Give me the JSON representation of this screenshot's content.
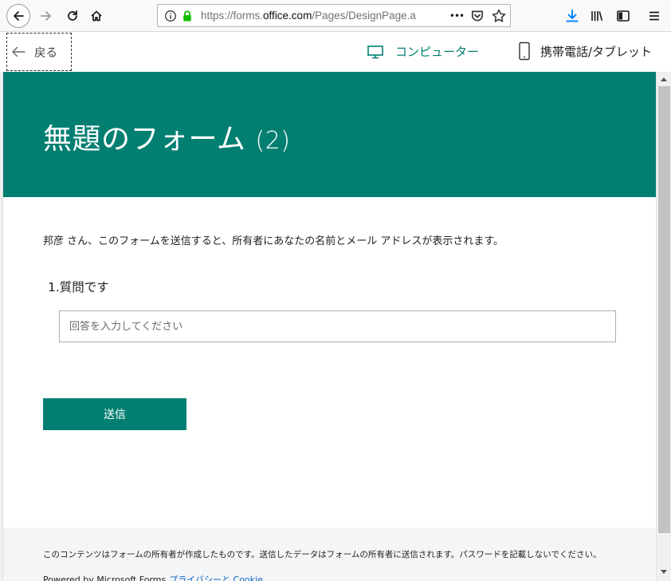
{
  "browser": {
    "url_prefix": "https://forms.",
    "url_domain": "office.com",
    "url_path": "/Pages/DesignPage.a",
    "more_glyph": "•••"
  },
  "topbar": {
    "back_label": "戻る",
    "computer_label": "コンピューター",
    "mobile_label": "携帯電話/タブレット",
    "accent_color": "#037f72"
  },
  "form": {
    "title": "無題のフォーム",
    "title_count": "(2)",
    "notice": "邦彦 さん、このフォームを送信すると、所有者にあなたの名前とメール アドレスが表示されます。",
    "question_number": "1.",
    "question_text": "質問です",
    "answer_placeholder": "回答を入力してください",
    "answer_value": "",
    "submit_label": "送信"
  },
  "footer": {
    "note": "このコンテンツはフォームの所有者が作成したものです。送信したデータはフォームの所有者に送信されます。パスワードを記載しないでください。",
    "powered_by": "Powered by Microsoft Forms",
    "privacy_link": "プライバシーと Cookie"
  },
  "icons": {
    "back": "arrow-left-icon",
    "forward": "arrow-right-icon",
    "reload": "reload-icon",
    "home": "home-icon",
    "info": "info-icon",
    "lock": "lock-icon",
    "pocket": "pocket-icon",
    "bookmark": "star-icon",
    "download": "download-icon",
    "library": "library-icon",
    "sidebar": "sidebar-icon",
    "menu": "hamburger-menu-icon",
    "monitor": "monitor-icon",
    "phone": "phone-icon"
  }
}
